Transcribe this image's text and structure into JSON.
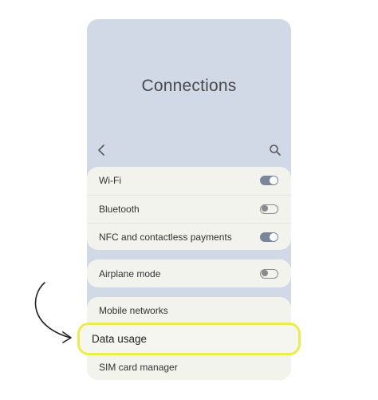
{
  "header": {
    "title": "Connections"
  },
  "icons": {
    "back": "chevron-left-icon",
    "search": "search-icon",
    "annotation": "curved-arrow-icon"
  },
  "group1": [
    {
      "label": "Wi-Fi",
      "toggle": "on"
    },
    {
      "label": "Bluetooth",
      "toggle": "off"
    },
    {
      "label": "NFC and contactless payments",
      "toggle": "on"
    }
  ],
  "group2": [
    {
      "label": "Airplane mode",
      "toggle": "off"
    }
  ],
  "group3": [
    {
      "label": "Mobile networks"
    },
    {
      "label": "Data usage",
      "highlighted": true
    },
    {
      "label": "SIM card manager"
    }
  ],
  "colors": {
    "background": "#d1d9e6",
    "card": "#f3f3ee",
    "highlight_border": "#ecec4a",
    "toggle_on": "#7a8699"
  }
}
